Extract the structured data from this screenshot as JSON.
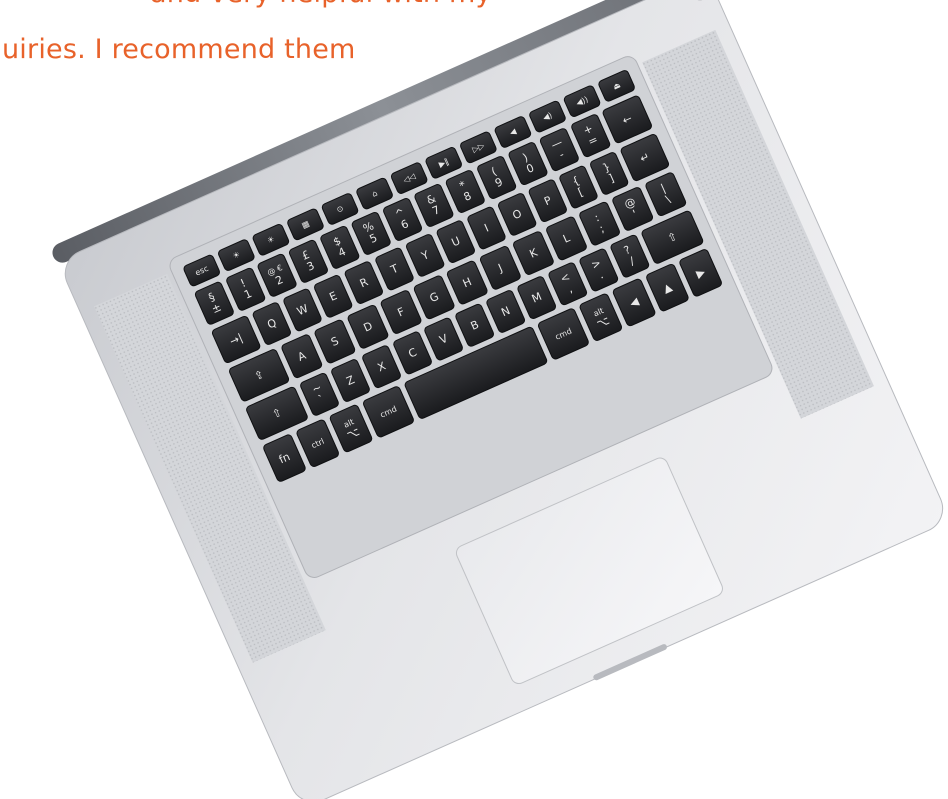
{
  "quote": {
    "partial_top_line": "and very helpful with my",
    "visible_line": "uiries. I recommend them",
    "accent_color": "#e8622a"
  },
  "laptop": {
    "description_icon": "laptop-keyboard-top-view",
    "rows": [
      [
        "esc",
        "☀",
        "☀",
        "▦",
        "⊙",
        "⌂",
        "◁◁",
        "▶‖",
        "▷▷",
        "◀",
        "◀)",
        "◀))",
        "⏏"
      ],
      [
        "§\n±",
        "!\n1",
        "@ €\n2",
        "£\n3",
        "$\n4",
        "%\n5",
        "^\n6",
        "&\n7",
        "*\n8",
        "(\n9",
        ")\n0",
        "—\n-",
        "+\n=",
        "←"
      ],
      [
        "→|",
        "Q",
        "W",
        "E",
        "R",
        "T",
        "Y",
        "U",
        "I",
        "O",
        "P",
        "{\n[",
        "}\n]",
        "↵"
      ],
      [
        "⇪",
        "A",
        "S",
        "D",
        "F",
        "G",
        "H",
        "J",
        "K",
        "L",
        ":\n;",
        "@\n'",
        "|\n\\"
      ],
      [
        "⇧",
        "~\n`",
        "Z",
        "X",
        "C",
        "V",
        "B",
        "N",
        "M",
        "<\n,",
        ">\n.",
        "?\n/",
        "⇧"
      ],
      [
        "fn",
        "ctrl",
        "alt\n⌥",
        "cmd",
        "",
        "cmd",
        "alt\n⌥",
        "◀",
        "▲",
        "▶"
      ]
    ]
  }
}
